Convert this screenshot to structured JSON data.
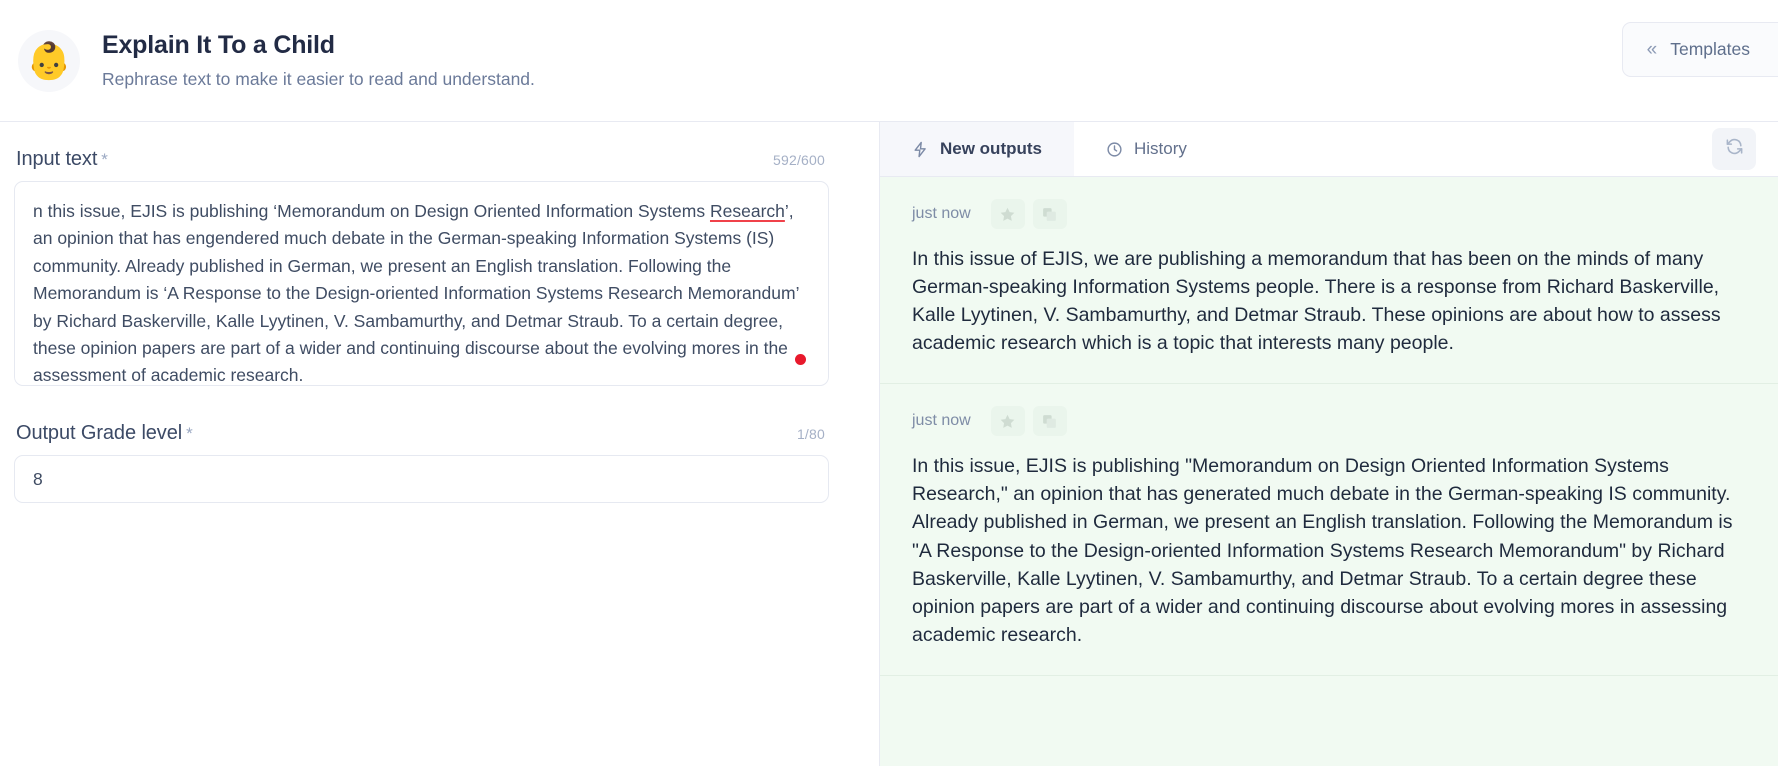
{
  "header": {
    "avatar_icon": "baby-emoji",
    "avatar_glyph": "👶",
    "title": "Explain It To a Child",
    "subtitle": "Rephrase text to make it easier to read and understand.",
    "templates_button": {
      "label": "Templates",
      "icon": "double-chevron-left-icon",
      "glyph": "«"
    }
  },
  "form": {
    "input_text": {
      "label": "Input text",
      "required_marker": "*",
      "counter": "592/600",
      "value": "n this issue, EJIS is publishing ‘Memorandum on Design Oriented Information Systems Research’, an opinion that has engendered much debate in the German-speaking Information Systems (IS) community. Already published in German, we present an English translation. Following the Memorandum is ‘A Response to the Design-oriented Information Systems Research Memorandum’ by Richard Baskerville, Kalle Lyytinen, V. Sambamurthy, and Detmar Straub. To a certain degree, these opinion papers are part of a wider and continuing discourse about the evolving mores in the assessment of academic research.",
      "value_part_1": "n this issue, EJIS is publishing ‘Memorandum on Design Oriented Information Systems ",
      "misspelled_word": "Research",
      "value_part_2": "’, an opinion that has engendered much debate in the German-speaking Information Systems (IS) community. Already published in German, we present an English translation. Following the Memorandum is ‘A Response to the Design-oriented Information Systems Research Memorandum’ by Richard Baskerville, Kalle Lyytinen, V. Sambamurthy, and Detmar Straub. To a certain degree, these opinion papers are part of a wider and continuing discourse about the evolving mores in the assessment of academic research.",
      "recording_indicator": "record-dot"
    },
    "grade_level": {
      "label": "Output Grade level",
      "required_marker": "*",
      "counter": "1/80",
      "value": "8",
      "placeholder": ""
    }
  },
  "output_panel": {
    "tabs": [
      {
        "label": "New outputs",
        "icon": "lightning-icon",
        "active": true
      },
      {
        "label": "History",
        "icon": "clock-icon",
        "active": false
      }
    ],
    "refresh_button": {
      "icon": "refresh-icon"
    },
    "cards": [
      {
        "time": "just now",
        "favorite_icon": "star-icon",
        "copy_icon": "copy-icon",
        "text": "In this issue of EJIS, we are publishing a memorandum that has been on the minds of many German-speaking Information Systems people. There is a response from Richard Baskerville, Kalle Lyytinen, V. Sambamurthy, and Detmar Straub. These opinions are about how to assess academic research which is a topic that interests many people."
      },
      {
        "time": "just now",
        "favorite_icon": "star-icon",
        "copy_icon": "copy-icon",
        "text": "In this issue, EJIS is publishing \"Memorandum on Design Oriented Information Systems Research,\" an opinion that has generated much debate in the German-speaking IS community. Already published in German, we present an English translation. Following the Memorandum is \"A Response to the Design-oriented Information Systems Research Memorandum\" by Richard Baskerville, Kalle Lyytinen, V. Sambamurthy, and Detmar Straub. To a certain degree these opinion papers are part of a wider and continuing discourse about evolving mores in assessing academic research."
      }
    ]
  },
  "colors": {
    "output_background": "#f1faf2",
    "accent_text": "#222b45",
    "muted_text": "#6b7a99",
    "record_dot": "#e8192c",
    "spellcheck_underline": "#f0414a",
    "border": "#e8eaf2",
    "active_tab_background": "#f6f7fb"
  }
}
